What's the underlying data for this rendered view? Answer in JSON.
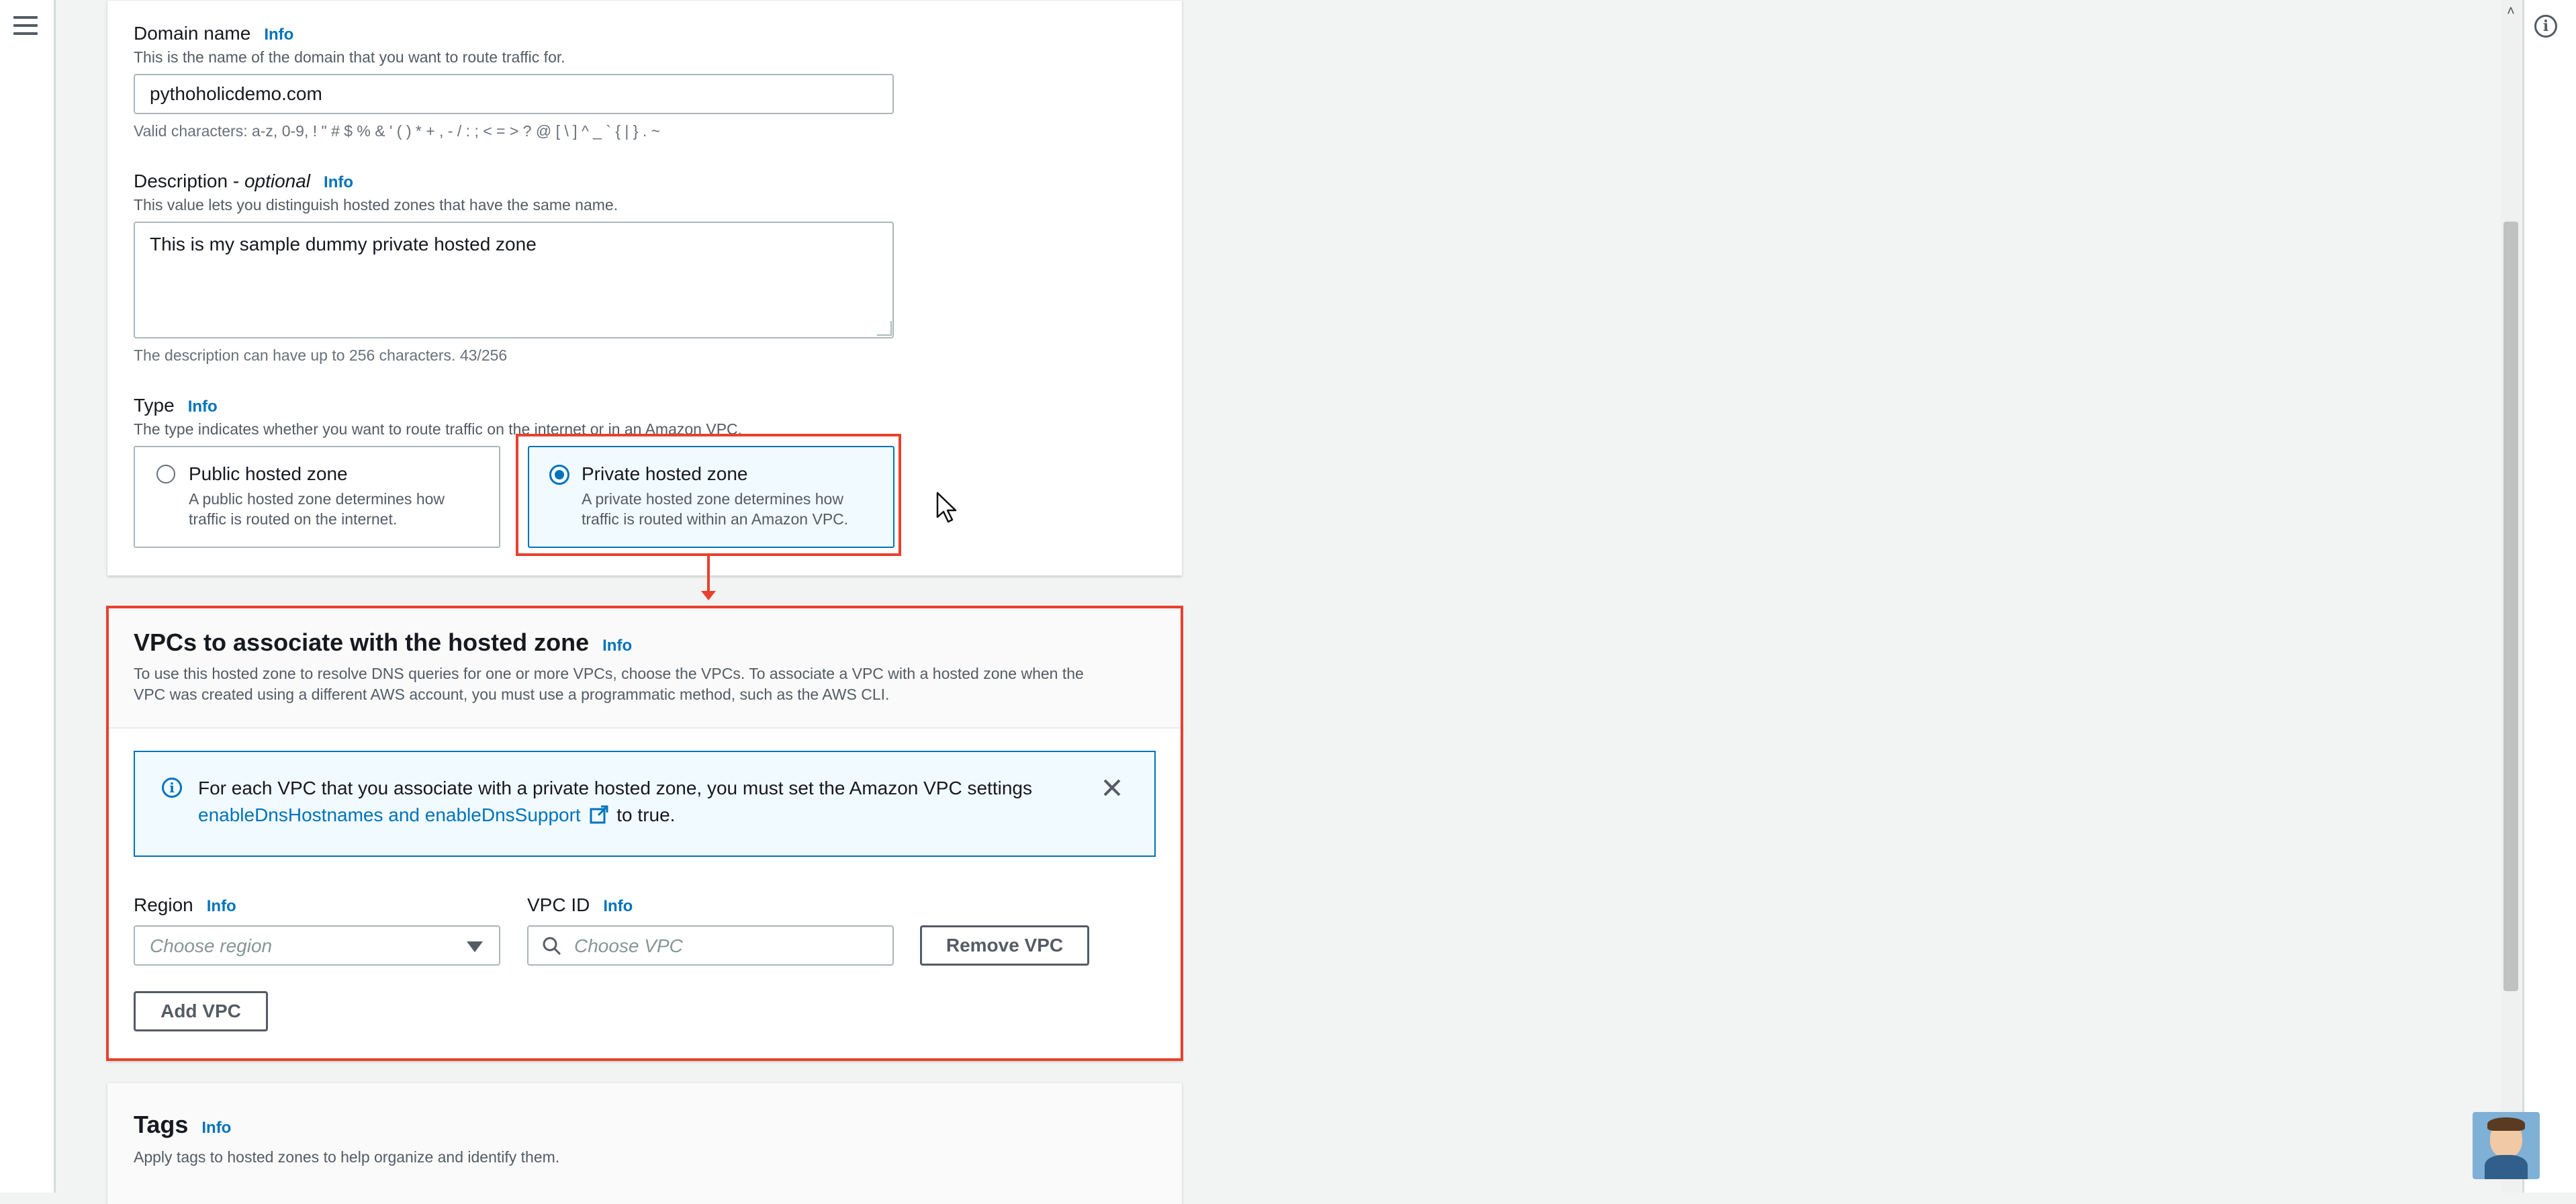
{
  "form": {
    "domain_name": {
      "label": "Domain name",
      "info": "Info",
      "description": "This is the name of the domain that you want to route traffic for.",
      "value": "pythoholicdemo.com",
      "hint": "Valid characters: a-z, 0-9, ! \" # $ % & ' ( ) * + , - / : ; < = > ? @ [ \\ ] ^ _ ` { | } . ~"
    },
    "description": {
      "label": "Description - ",
      "label_optional": "optional",
      "info": "Info",
      "description": "This value lets you distinguish hosted zones that have the same name.",
      "value": "This is my sample dummy private hosted zone",
      "hint": "The description can have up to 256 characters. 43/256"
    },
    "type": {
      "label": "Type",
      "info": "Info",
      "description": "The type indicates whether you want to route traffic on the internet or in an Amazon VPC.",
      "options": [
        {
          "title": "Public hosted zone",
          "line1": "A public hosted zone determines how",
          "line2": "traffic is routed on the internet.",
          "selected": false
        },
        {
          "title": "Private hosted zone",
          "line1": "A private hosted zone determines how",
          "line2": "traffic is routed within an Amazon VPC.",
          "selected": true
        }
      ]
    }
  },
  "vpcs": {
    "title": "VPCs to associate with the hosted zone",
    "info": "Info",
    "description_line1": "To use this hosted zone to resolve DNS queries for one or more VPCs, choose the VPCs. To associate a VPC with a hosted zone when the",
    "description_line2": "VPC was created using a different AWS account, you must use a programmatic method, such as the AWS CLI.",
    "alert": {
      "text": "For each VPC that you associate with a private hosted zone, you must set the Amazon VPC settings",
      "link": "enableDnsHostnames and enableDnsSupport",
      "suffix": "to true."
    },
    "region_label": "Region",
    "region_info": "Info",
    "region_placeholder": "Choose region",
    "vpc_id_label": "VPC ID",
    "vpc_id_info": "Info",
    "vpc_id_placeholder": "Choose VPC",
    "remove_button": "Remove VPC",
    "add_button": "Add VPC"
  },
  "tags": {
    "title": "Tags",
    "info": "Info",
    "description": "Apply tags to hosted zones to help organize and identify them."
  },
  "colors": {
    "accent": "#0073bb",
    "annotation_red": "#e8412c",
    "selected_bg": "#f1faff",
    "alert_bg": "#f1faff"
  }
}
